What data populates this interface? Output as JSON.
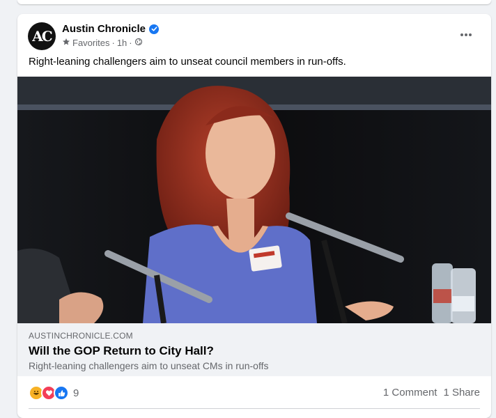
{
  "post": {
    "page_name": "Austin Chronicle",
    "avatar_text": "AC",
    "audience": "Favorites",
    "time": "1h",
    "separator": "·",
    "caption": "Right-leaning challengers aim to unseat council members in run-offs."
  },
  "link": {
    "domain": "AUSTINCHRONICLE.COM",
    "title": "Will the GOP Return to City Hall?",
    "description": "Right-leaning challengers aim to unseat CMs in run-offs"
  },
  "stats": {
    "reaction_count": "9",
    "comments": "1 Comment",
    "shares": "1 Share"
  },
  "icons": {
    "verified": "verified-badge-icon",
    "audience": "star-icon",
    "globe": "globe-icon",
    "more": "more-options-icon",
    "reactions": [
      "haha-icon",
      "love-icon",
      "like-icon"
    ]
  },
  "colors": {
    "accent": "#1877f2",
    "love": "#f33e58",
    "haha": "#f7b125",
    "secondary_text": "#65676b",
    "link_bg": "#f0f2f5"
  }
}
